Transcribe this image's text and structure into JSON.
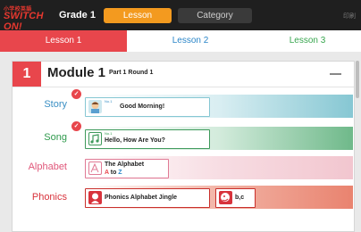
{
  "header": {
    "logo_small": "小学校英語",
    "logo_big": "SWITCH ON!",
    "grade": "Grade 1",
    "tabs": [
      {
        "label": "Lesson"
      },
      {
        "label": "Category"
      }
    ],
    "print_label": "印刷"
  },
  "lesson_tabs": [
    {
      "label": "Lesson 1"
    },
    {
      "label": "Lesson 2"
    },
    {
      "label": "Lesson 3"
    }
  ],
  "module": {
    "number": "1",
    "title": "Module 1",
    "subtitle": "Part 1 Round 1"
  },
  "rows": [
    {
      "label": "Story",
      "items": [
        {
          "no": "No.1",
          "title": "Good Morning!",
          "completed": true,
          "icon": "character-icon"
        }
      ]
    },
    {
      "label": "Song",
      "items": [
        {
          "no": "No.1",
          "title": "Hello, How Are You?",
          "completed": true,
          "icon": "music-icon"
        }
      ]
    },
    {
      "label": "Alphabet",
      "items": [
        {
          "title_line1": "The Alphabet",
          "title_line2_a": "A",
          "title_line2_to": " to ",
          "title_line2_z": "Z",
          "icon": "alphabet-icon"
        }
      ]
    },
    {
      "label": "Phonics",
      "items": [
        {
          "title": "Phonics Alphabet Jingle",
          "icon": "phonics-icon"
        },
        {
          "title": "b,c",
          "icon": "phonics-face-icon"
        }
      ]
    }
  ],
  "colors": {
    "accent_red": "#e8464c",
    "lesson_orange": "#f39a1f",
    "story_blue": "#86c7d3",
    "song_green": "#6fb98a",
    "alphabet_pink": "#f2c6cf",
    "phonics_salmon": "#e9836f"
  }
}
